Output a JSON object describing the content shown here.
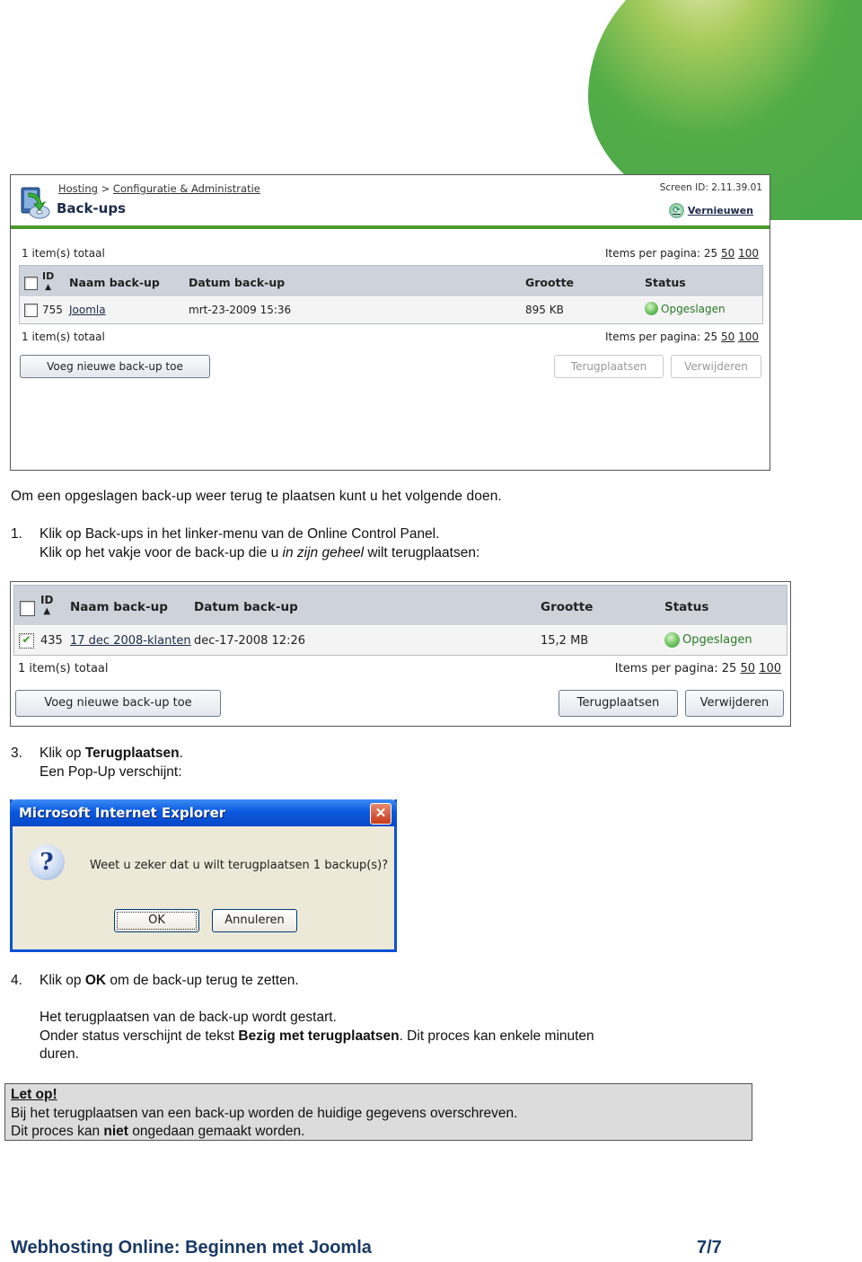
{
  "screenshot1": {
    "breadcrumb": {
      "hosting": "Hosting",
      "sep": ">",
      "config": "Configuratie & Administratie"
    },
    "page_title": "Back-ups",
    "screen_id": "Screen ID: 2.11.39.01",
    "refresh_label": "Vernieuwen",
    "count_top": "1 item(s) totaal",
    "count_bottom": "1 item(s) totaal",
    "ipp_label": "Items per pagina: 25",
    "ipp_50": "50",
    "ipp_100": "100",
    "columns": {
      "id": "ID",
      "sort": "▲",
      "name": "Naam back-up",
      "date": "Datum back-up",
      "size": "Grootte",
      "status": "Status"
    },
    "rows": [
      {
        "id": "755",
        "name": "Joomla",
        "date": "mrt-23-2009 15:36",
        "size": "895 KB",
        "status": "Opgeslagen",
        "checked": false
      }
    ],
    "buttons": {
      "add": "Voeg nieuwe back-up toe",
      "restore": "Terugplaatsen",
      "delete": "Verwijderen"
    }
  },
  "text": {
    "intro": "Om een opgeslagen back-up weer terug te plaatsen kunt u het volgende doen.",
    "step1_num": "1.",
    "step1_line1": "Klik op Back-ups in het linker-menu van de Online Control Panel.",
    "step1_line2_a": "Klik op het vakje voor de back-up die u ",
    "step1_line2_em": "in zijn geheel",
    "step1_line2_b": " wilt terugplaatsen:",
    "step3_num": "3.",
    "step3_a": "Klik op ",
    "step3_b": "Terugplaatsen",
    "step3_c": ".",
    "step3_line2": "Een Pop-Up verschijnt:",
    "step4_num": "4.",
    "step4_a": "Klik op ",
    "step4_b": "OK",
    "step4_c": " om de back-up terug te zetten.",
    "step4_p1": "Het terugplaatsen van de back-up wordt gestart.",
    "step4_p2_a": "Onder status verschijnt de tekst ",
    "step4_p2_b": "Bezig met terugplaatsen",
    "step4_p2_c": ". Dit proces kan enkele minuten",
    "step4_p3": "duren."
  },
  "screenshot2": {
    "columns": {
      "id": "ID",
      "sort": "▲",
      "name": "Naam back-up",
      "date": "Datum back-up",
      "size": "Grootte",
      "status": "Status"
    },
    "rows": [
      {
        "id": "435",
        "name": "17 dec 2008-klanten",
        "date": "dec-17-2008 12:26",
        "size": "15,2 MB",
        "status": "Opgeslagen",
        "checked": true
      }
    ],
    "count": "1 item(s) totaal",
    "ipp_label": "Items per pagina: 25",
    "ipp_50": "50",
    "ipp_100": "100",
    "buttons": {
      "add": "Voeg nieuwe back-up toe",
      "restore": "Terugplaatsen",
      "delete": "Verwijderen"
    }
  },
  "dialog": {
    "title": "Microsoft Internet Explorer",
    "close": "✕",
    "question_icon": "?",
    "message": "Weet u zeker dat u wilt terugplaatsen 1 backup(s)?",
    "ok": "OK",
    "cancel": "Annuleren"
  },
  "note": {
    "heading": "Let op!",
    "line1": "Bij het terugplaatsen van een back-up worden de huidige gegevens overschreven.",
    "line2_a": "Dit proces kan ",
    "line2_b": "niet",
    "line2_c": " ongedaan gemaakt worden."
  },
  "footer": {
    "title": "Webhosting Online: Beginnen met Joomla",
    "page": "7/7"
  },
  "colors": {
    "brand_green": "#46a848",
    "header_rule": "#4a9a2c",
    "footer_text": "#1a3a64",
    "status_green": "#2a7a2a"
  }
}
